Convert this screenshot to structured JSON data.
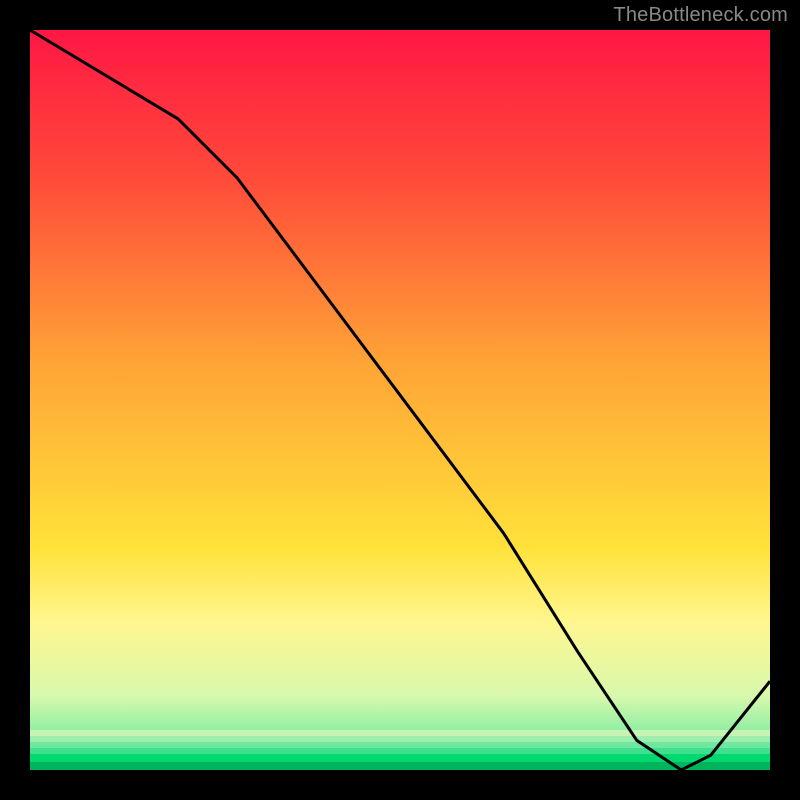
{
  "watermark": "TheBottleneck.com",
  "x_label_text": "",
  "chart_data": {
    "type": "line",
    "title": "",
    "xlabel": "",
    "ylabel": "",
    "xlim": [
      0,
      100
    ],
    "ylim": [
      0,
      100
    ],
    "grid": false,
    "legend": null,
    "gradient_stops": [
      {
        "pct": 0,
        "color": "#ff1744"
      },
      {
        "pct": 20,
        "color": "#ff4a3a"
      },
      {
        "pct": 45,
        "color": "#ffa436"
      },
      {
        "pct": 70,
        "color": "#ffe23a"
      },
      {
        "pct": 80,
        "color": "#fff68f"
      },
      {
        "pct": 90,
        "color": "#d8f9ad"
      },
      {
        "pct": 95,
        "color": "#8ceea2"
      },
      {
        "pct": 98.5,
        "color": "#00d96f"
      },
      {
        "pct": 100,
        "color": "#009e5a"
      }
    ],
    "series": [
      {
        "name": "bottleneck-curve",
        "x": [
          0,
          10,
          20,
          28,
          40,
          52,
          64,
          74,
          82,
          88,
          92,
          100
        ],
        "y": [
          100,
          94,
          88,
          80,
          64,
          48,
          32,
          16,
          4,
          0,
          2,
          12
        ]
      }
    ],
    "annotations": []
  }
}
